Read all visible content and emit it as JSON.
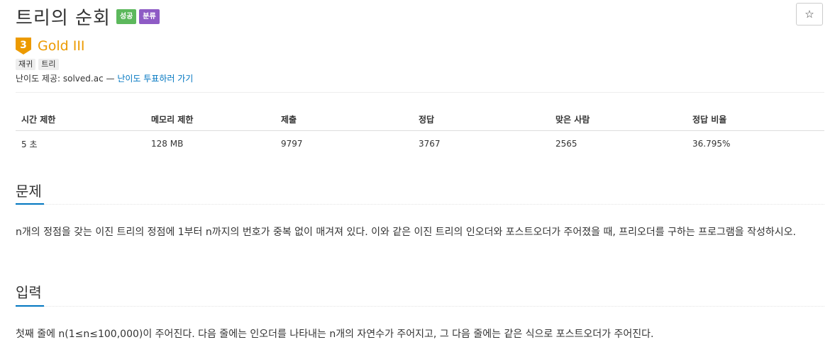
{
  "problem": {
    "title": "트리의 순회",
    "badges": [
      "성공",
      "분류"
    ]
  },
  "star_button": {
    "icon": "star-outline-icon",
    "glyph": "☆"
  },
  "tier": {
    "number": "3",
    "label": "Gold III",
    "color": "#ec9a00"
  },
  "tags": [
    "재귀",
    "트리"
  ],
  "credit": {
    "prefix": "난이도 제공: solved.ac —",
    "link": "난이도 투표하러 가기"
  },
  "stats": {
    "headers": [
      "시간 제한",
      "메모리 제한",
      "제출",
      "정답",
      "맞은 사람",
      "정답 비율"
    ],
    "values": [
      "5 초",
      "128 MB",
      "9797",
      "3767",
      "2565",
      "36.795%"
    ]
  },
  "sections": {
    "problem": {
      "title": "문제",
      "text": "n개의 정점을 갖는 이진 트리의 정점에 1부터 n까지의 번호가 중복 없이 매겨져 있다. 이와 같은 이진 트리의 인오더와 포스트오더가 주어졌을 때, 프리오더를 구하는 프로그램을 작성하시오."
    },
    "input": {
      "title": "입력",
      "text": "첫째 줄에 n(1≤n≤100,000)이 주어진다. 다음 줄에는 인오더를 나타내는 n개의 자연수가 주어지고, 그 다음 줄에는 같은 식으로 포스트오더가 주어진다."
    }
  },
  "colors": {
    "success_badge": "#5cb85c",
    "category_badge": "#8e5bc5",
    "link": "#0076c0",
    "section_accent": "#0076c0"
  }
}
